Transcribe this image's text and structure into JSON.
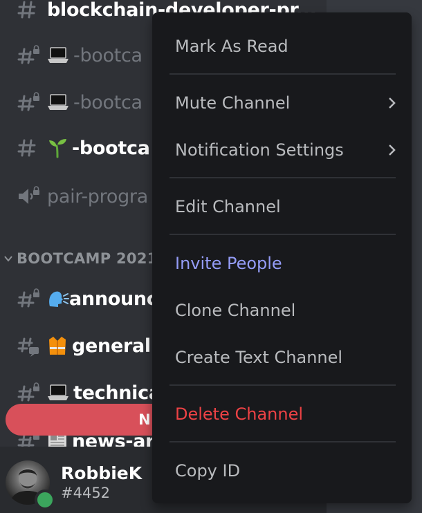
{
  "sidebar": {
    "channels_top": [
      {
        "label": "blockchain-developer-pr..."
      },
      {
        "label": "-bootca"
      },
      {
        "label": "-bootca"
      },
      {
        "label": "-bootca"
      },
      {
        "label": "pair-progra"
      }
    ],
    "category": {
      "label": "BOOTCAMP 2021"
    },
    "channels_cat": [
      {
        "label": "announc"
      },
      {
        "label": "general"
      },
      {
        "label": "technica"
      },
      {
        "label": "news-ar"
      }
    ],
    "new_messages": "NEW M"
  },
  "user": {
    "name": "RobbieK",
    "tag": "#4452",
    "status_color": "#3ba55d"
  },
  "context_menu": {
    "mark_as_read": "Mark As Read",
    "mute_channel": "Mute Channel",
    "notification_settings": "Notification Settings",
    "edit_channel": "Edit Channel",
    "invite_people": "Invite People",
    "clone_channel": "Clone Channel",
    "create_text_channel": "Create Text Channel",
    "delete_channel": "Delete Channel",
    "copy_id": "Copy ID"
  },
  "colors": {
    "invite": "#949cf7",
    "danger": "#ed4245",
    "banner": "#d8505a",
    "menu_bg": "#18191c"
  }
}
